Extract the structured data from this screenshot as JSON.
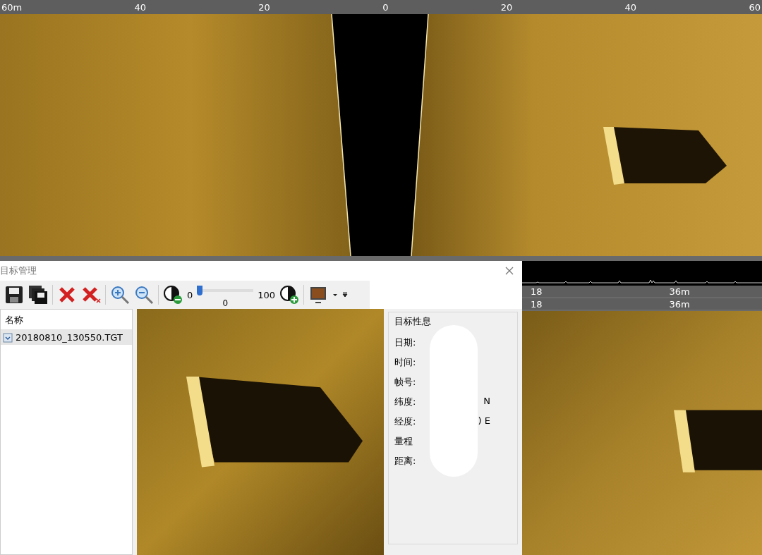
{
  "top_ruler": {
    "ticks": [
      "60m",
      "40",
      "20",
      "0",
      "20",
      "40",
      "60"
    ]
  },
  "target_manager": {
    "title": "目标管理",
    "toolbar": {
      "contrast_min": "0",
      "contrast_max": "100",
      "slider": {
        "level": 0,
        "value": "0"
      }
    },
    "list": {
      "header": "名称",
      "items": [
        {
          "name": "20180810_130550.TGT",
          "selected": true
        }
      ]
    },
    "info": {
      "title": "目标性息",
      "fields": [
        {
          "label": "日期:"
        },
        {
          "label": "时间:"
        },
        {
          "label": "帧号:"
        },
        {
          "label": "纬度:",
          "value": "N"
        },
        {
          "label": "经度:",
          "value": ") E"
        },
        {
          "label": "量程"
        },
        {
          "label": "距离:"
        }
      ]
    }
  },
  "right_panel": {
    "rulers": [
      {
        "ticks": [
          "18",
          "36m"
        ]
      },
      {
        "ticks": [
          "18",
          "36m"
        ]
      }
    ]
  }
}
